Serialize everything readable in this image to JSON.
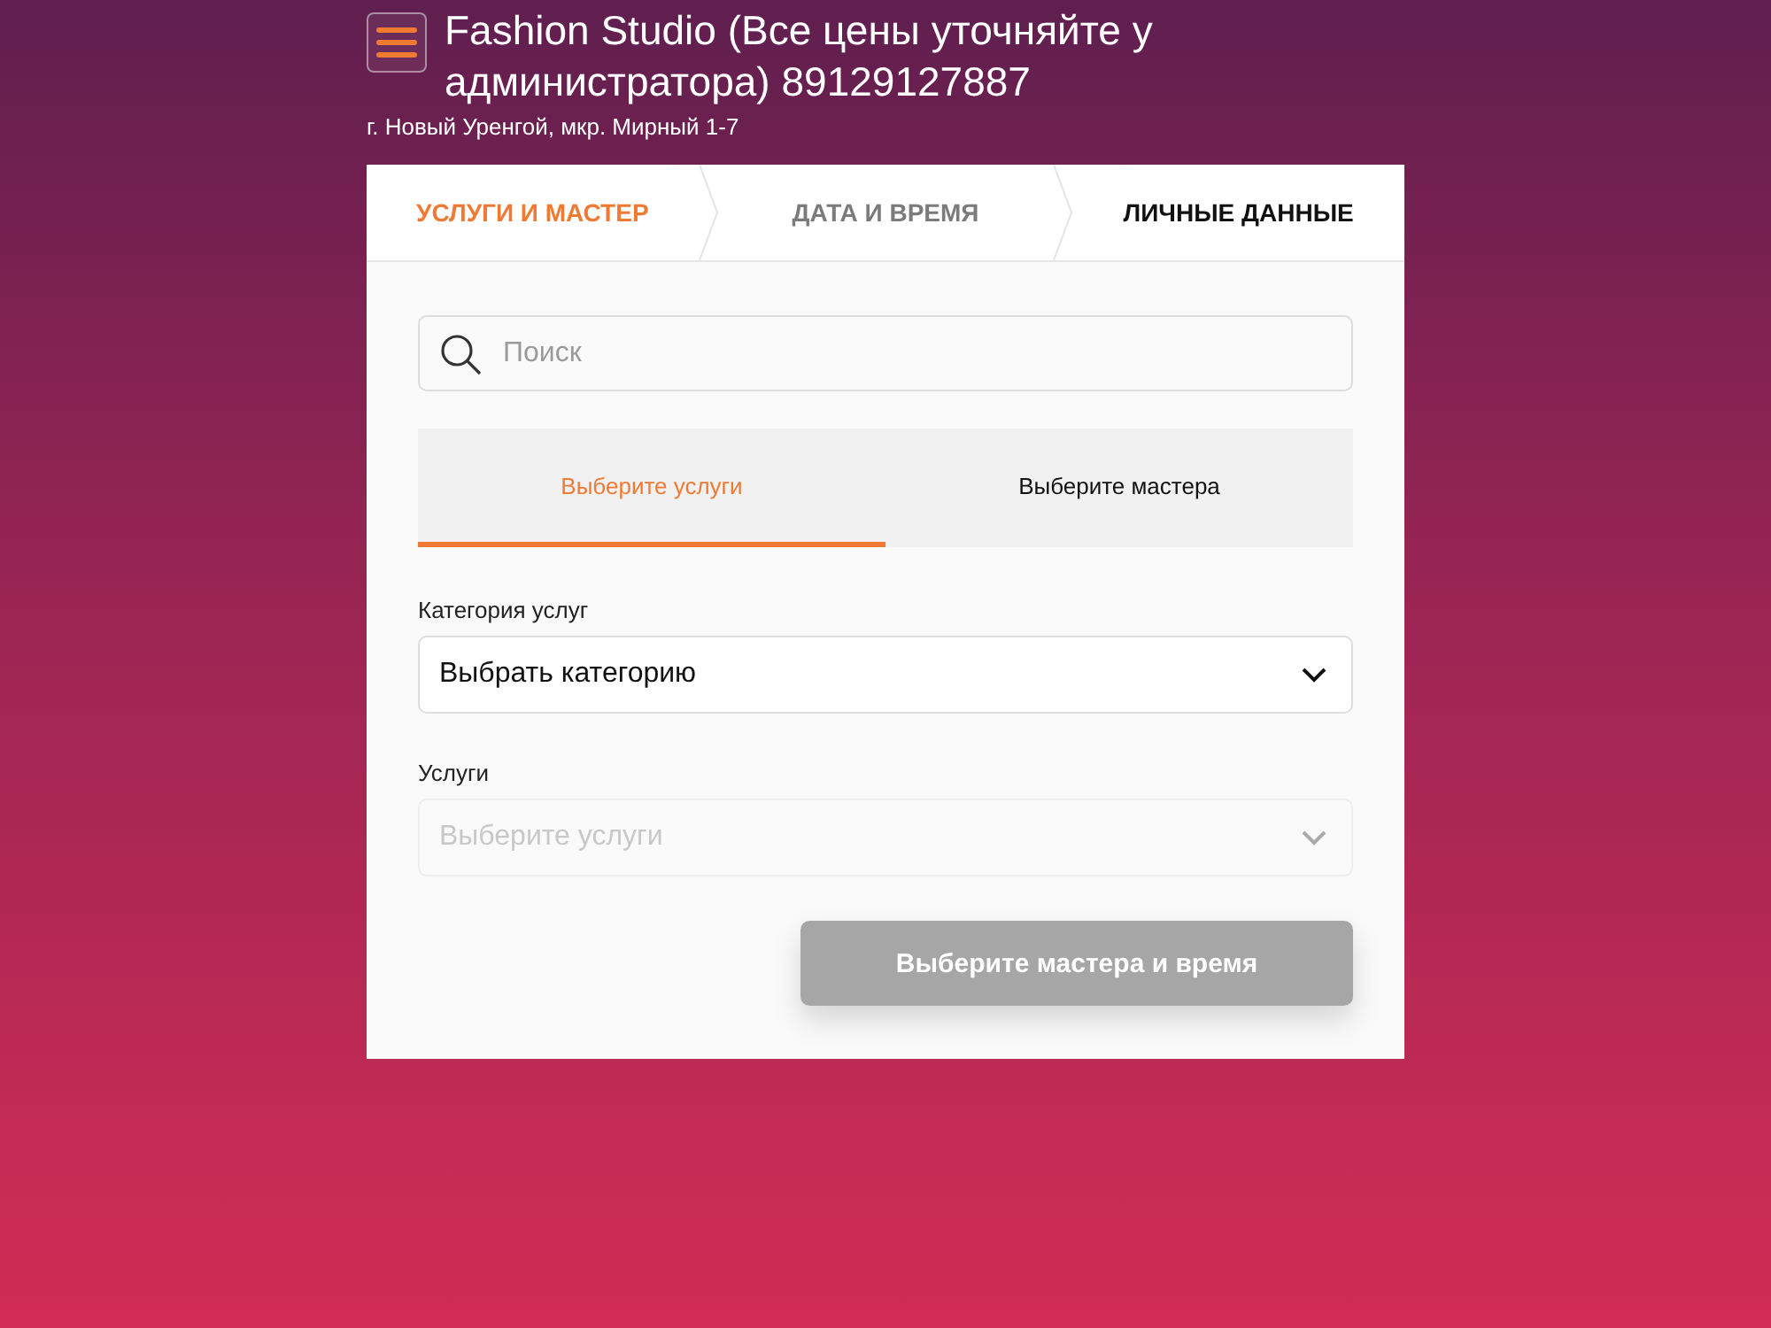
{
  "header": {
    "title": "Fashion Studio (Все цены уточняйте у администратора) 89129127887",
    "address": "г. Новый Уренгой, мкр. Мирный 1-7"
  },
  "steps": [
    {
      "label": "УСЛУГИ И МАСТЕР",
      "selected": true,
      "disabled": false
    },
    {
      "label": "ДАТА И ВРЕМЯ",
      "selected": false,
      "disabled": true
    },
    {
      "label": "ЛИЧНЫЕ ДАННЫЕ",
      "selected": false,
      "disabled": false
    }
  ],
  "search": {
    "placeholder": "Поиск"
  },
  "tabs": [
    {
      "label": "Выберите услуги",
      "selected": true
    },
    {
      "label": "Выберите мастера",
      "selected": false
    }
  ],
  "fields": [
    {
      "label": "Категория услуг",
      "value": "Выбрать категорию",
      "disabled": false
    },
    {
      "label": "Услуги",
      "placeholder": "Выберите услуги",
      "disabled": true
    }
  ],
  "submit": {
    "label": "Выберите мастера и время",
    "disabled": true
  }
}
